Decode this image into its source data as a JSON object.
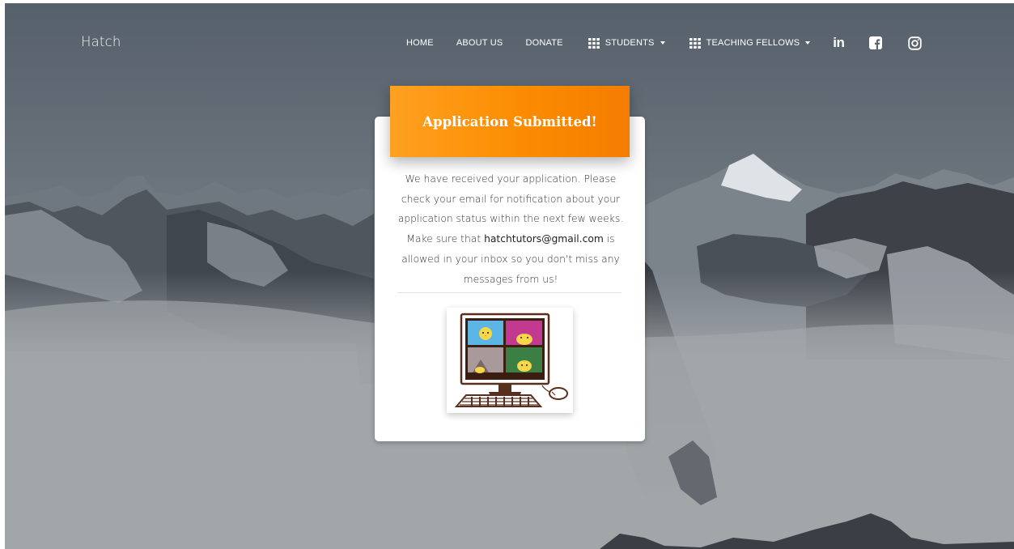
{
  "brand": {
    "name": "Hatch"
  },
  "nav": {
    "items": [
      {
        "label": "HOME"
      },
      {
        "label": "ABOUT US"
      },
      {
        "label": "DONATE"
      },
      {
        "label": "STUDENTS"
      },
      {
        "label": "TEACHING FELLOWS"
      }
    ],
    "social": {
      "linkedin_text": "in",
      "facebook_text": "f"
    }
  },
  "card": {
    "title": "Application Submitted!",
    "message_before": "We have received your application. Please check your email for notification about your application status within the next few weeks. Make sure that ",
    "email": "hatchtutors@gmail.com",
    "message_after": " is allowed in your inbox so you don't miss any messages from us!"
  },
  "icons": {
    "grid": "grid-icon",
    "caret": "caret-down-icon",
    "linkedin": "linkedin-icon",
    "facebook": "facebook-icon",
    "instagram": "instagram-icon"
  },
  "colors": {
    "header_start": "#ffa121",
    "header_end": "#f57c00",
    "nav_text": "#ffffff"
  }
}
